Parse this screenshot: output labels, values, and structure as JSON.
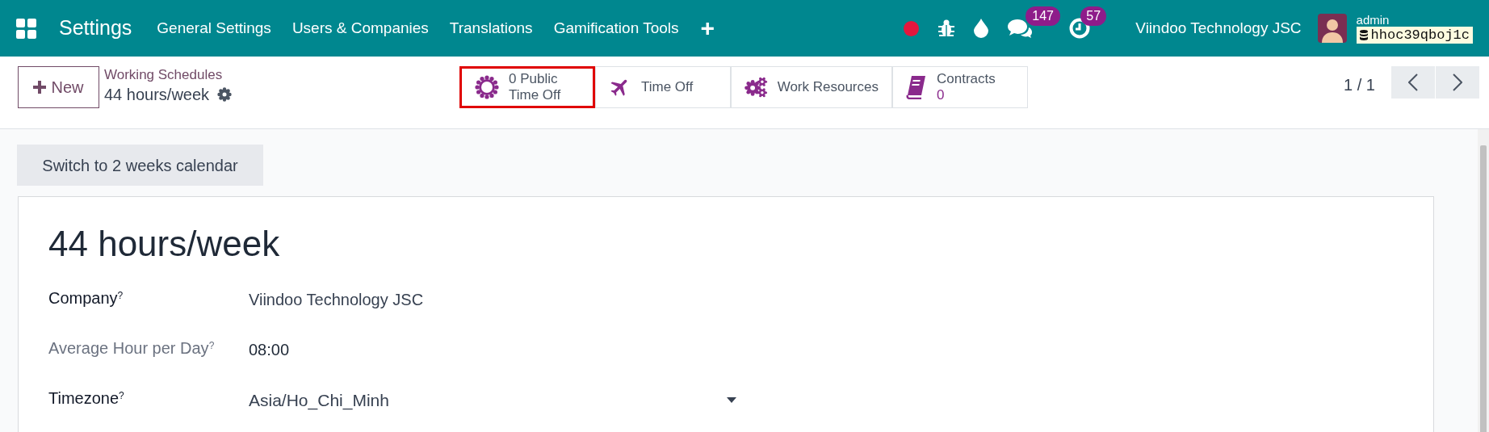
{
  "navbar": {
    "app": "Settings",
    "menu": [
      "General Settings",
      "Users & Companies",
      "Translations",
      "Gamification Tools"
    ],
    "plus": "+",
    "messages_badge": "147",
    "activities_badge": "57",
    "company": "Viindoo Technology JSC",
    "user": "admin",
    "database": "hhoc39qboj1c"
  },
  "control_panel": {
    "new_button": "New",
    "breadcrumb": "Working Schedules",
    "record": "44 hours/week",
    "stat_buttons": [
      {
        "lines": [
          "0 Public",
          "Time Off"
        ],
        "highlighted": true
      },
      {
        "lines": [
          "Time Off"
        ],
        "highlighted": false
      },
      {
        "lines": [
          "Work Resources"
        ],
        "highlighted": false
      },
      {
        "lines": [
          "Contracts"
        ],
        "value": "0",
        "highlighted": false
      }
    ],
    "pager": "1 / 1"
  },
  "form": {
    "switch_button": "Switch to 2 weeks calendar",
    "title": "44 hours/week",
    "fields": [
      {
        "label": "Company",
        "help": "?",
        "value": "Viindoo Technology JSC",
        "readonly": false,
        "kind": "many2one"
      },
      {
        "label": "Average Hour per Day",
        "help": "?",
        "value": "08:00",
        "readonly": true,
        "kind": "text"
      },
      {
        "label": "Timezone",
        "help": "?",
        "value": "Asia/Ho_Chi_Minh",
        "readonly": false,
        "kind": "select"
      }
    ]
  }
}
